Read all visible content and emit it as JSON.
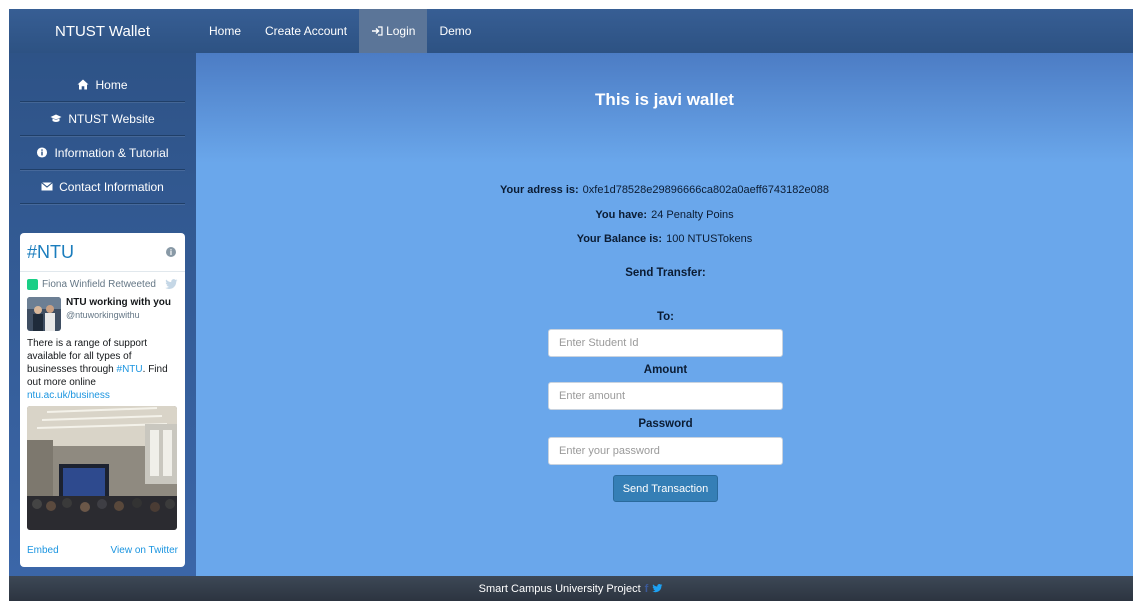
{
  "app": {
    "brand": "NTUST Wallet"
  },
  "navbar": {
    "items": [
      {
        "label": "Home"
      },
      {
        "label": "Create Account"
      },
      {
        "label": "Login",
        "icon": "login-icon",
        "active": true
      },
      {
        "label": "Demo"
      }
    ]
  },
  "sidebar": {
    "items": [
      {
        "label": "Home",
        "icon": "home-icon"
      },
      {
        "label": "NTUST Website",
        "icon": "graduation-cap-icon"
      },
      {
        "label": "Information & Tutorial",
        "icon": "info-icon"
      },
      {
        "label": "Contact Information",
        "icon": "envelope-icon"
      }
    ]
  },
  "twitter": {
    "title": "#NTU",
    "retweeted_by": "Fiona Winfield Retweeted",
    "author_name": "NTU working with you",
    "author_handle": "@ntuworkingwithu",
    "text_1": "There is a range of support available for all types of businesses through ",
    "hashtag": "#NTU",
    "text_2": ". Find out more online ",
    "link": "ntu.ac.uk/business",
    "embed": "Embed",
    "view_on_twitter": "View on Twitter"
  },
  "main": {
    "title": "This is javi wallet",
    "address_label": "Your adress is:",
    "address_value": "0xfe1d78528e29896666ca802a0aeff6743182e088",
    "have_label": "You have:",
    "have_value": "24 Penalty Poins",
    "balance_label": "Your Balance is:",
    "balance_value": "100 NTUSTokens",
    "send_transfer": "Send Transfer:",
    "to_label": "To:",
    "to_placeholder": "Enter Student Id",
    "amount_label": "Amount",
    "amount_placeholder": "Enter amount",
    "password_label": "Password",
    "password_placeholder": "Enter your password",
    "send_button": "Send Transaction"
  },
  "footer": {
    "text": "Smart Campus University Project"
  },
  "colors": {
    "navbar": "#2f5586",
    "main_bg": "#6aa7eb",
    "button": "#357fb6",
    "footer": "#343d49"
  }
}
